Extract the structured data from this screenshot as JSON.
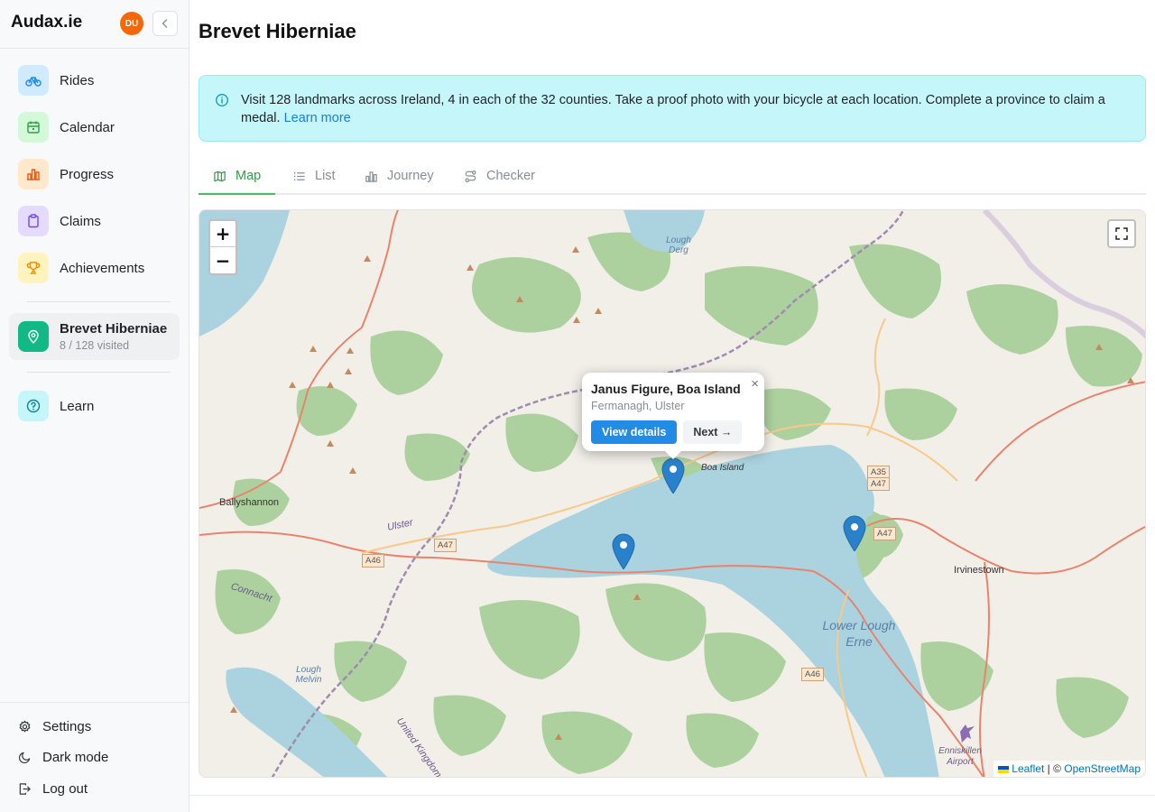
{
  "app": {
    "brand": "Audax.ie",
    "avatar_initials": "DU"
  },
  "sidebar": {
    "items": [
      {
        "label": "Rides",
        "icon": "bike-icon",
        "color": "#228be6",
        "bg": "#d0ebff"
      },
      {
        "label": "Calendar",
        "icon": "calendar-icon",
        "color": "#2f9e44",
        "bg": "#d3f9d8"
      },
      {
        "label": "Progress",
        "icon": "chart-bar-icon",
        "color": "#e8590c",
        "bg": "#ffe8cc"
      },
      {
        "label": "Claims",
        "icon": "clipboard-icon",
        "color": "#7048e8",
        "bg": "#e5dbff"
      },
      {
        "label": "Achievements",
        "icon": "trophy-icon",
        "color": "#f08c00",
        "bg": "#fff3bf"
      }
    ],
    "active": {
      "label": "Brevet Hiberniae",
      "sub": "8 / 128 visited",
      "icon": "map-pin-icon",
      "color": "#12b886"
    },
    "learn": {
      "label": "Learn",
      "icon": "help-circle-icon",
      "color": "#0c8599",
      "bg": "#c5f6fa"
    },
    "bottom": [
      {
        "label": "Settings",
        "icon": "gear-icon"
      },
      {
        "label": "Dark mode",
        "icon": "moon-icon"
      },
      {
        "label": "Log out",
        "icon": "logout-icon"
      }
    ]
  },
  "main": {
    "title": "Brevet Hiberniae",
    "info": {
      "text": "Visit 128 landmarks across Ireland, 4 in each of the 32 counties. Take a proof photo with your bicycle at each location. Complete a province to claim a medal.",
      "link": "Learn more"
    },
    "tabs": [
      {
        "label": "Map",
        "icon": "map-icon",
        "active": true
      },
      {
        "label": "List",
        "icon": "list-icon",
        "active": false
      },
      {
        "label": "Journey",
        "icon": "chart-bar-icon",
        "active": false
      },
      {
        "label": "Checker",
        "icon": "route-icon",
        "active": false
      }
    ]
  },
  "map": {
    "zoom_in": "+",
    "zoom_out": "−",
    "popup": {
      "title": "Janus Figure, Boa Island",
      "subtitle": "Fermanagh, Ulster",
      "primary_button": "View details",
      "secondary_button": "Next →",
      "close": "×"
    },
    "labels": {
      "lough_derg": "Lough Derg",
      "boa_island": "Boa Island",
      "ballyshannon": "Ballyshannon",
      "ulster": "Ulster",
      "connacht": "Connacht",
      "irvinestown": "Irvinestown",
      "lower_lough_erne": "Lower Lough Erne",
      "lough_melvin": "Lough Melvin",
      "united_kingdom": "United Kingdom",
      "enniskillen_airport": "Enniskillen Airport"
    },
    "road_shields": {
      "a35": "A35",
      "a47_top": "A47",
      "a47_right": "A47",
      "a47_left": "A47",
      "a46_left": "A46",
      "a46_bottom": "A46"
    },
    "attribution": {
      "leaflet": "Leaflet",
      "sep": " | © ",
      "osm": "OpenStreetMap"
    },
    "colors": {
      "land": "#f2efe9",
      "forest": "#add19e",
      "water": "#aad3df",
      "road_major": "#e8846d",
      "road_minor": "#f7c98b",
      "border": "#9e8cb0",
      "marker": "#2a81cb"
    }
  }
}
